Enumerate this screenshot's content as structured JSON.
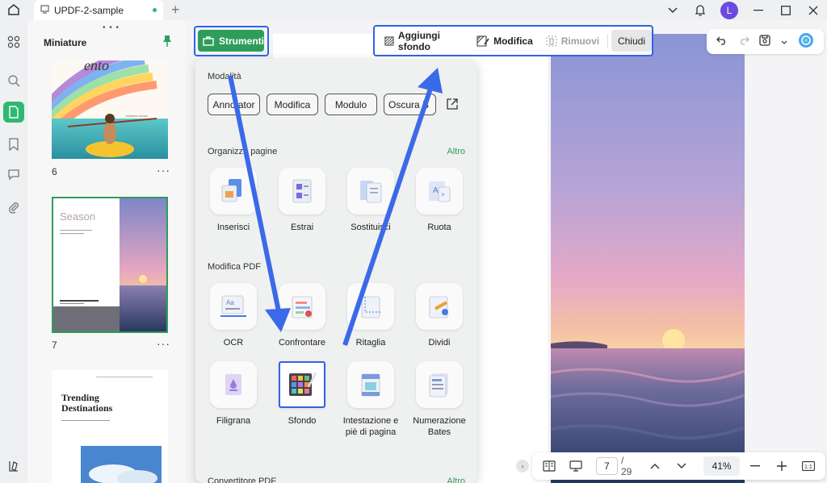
{
  "window": {
    "tab_title": "UPDF-2-sample",
    "avatar_letter": "L"
  },
  "thumbnails": {
    "title": "Miniature",
    "pages": [
      {
        "number": "6"
      },
      {
        "number": "7",
        "title": "Season"
      },
      {
        "number": "",
        "title_line1": "Trending",
        "title_line2": "Destinations"
      }
    ],
    "more": "···"
  },
  "toolbar": {
    "strumenti_label": "Strumenti",
    "add_background_label": "Aggiungi sfondo",
    "edit_label": "Modifica",
    "remove_label": "Rimuovi",
    "close_label": "Chiudi"
  },
  "panel": {
    "mode_title": "Modalità",
    "modes": [
      "Annotator",
      "Modifica",
      "Modulo",
      "Oscura B"
    ],
    "organize_title": "Organizza pagine",
    "more_label": "Altro",
    "organize_tools": [
      "Inserisci",
      "Estrai",
      "Sostituisci",
      "Ruota"
    ],
    "edit_pdf_title": "Modifica PDF",
    "edit_tools_row1": [
      "OCR",
      "Confrontare",
      "Ritaglia",
      "Dividi"
    ],
    "edit_tools_row2": [
      "Filigrana",
      "Sfondo",
      "Intestazione e piè di pagina",
      "Numerazione Bates"
    ],
    "converter_title": "Convertitore PDF"
  },
  "bottom": {
    "current_page": "7",
    "total_pages": "/ 29",
    "zoom": "41%"
  },
  "colors": {
    "accent_green": "#2e9d5c",
    "highlight_blue": "#2f64e8"
  }
}
